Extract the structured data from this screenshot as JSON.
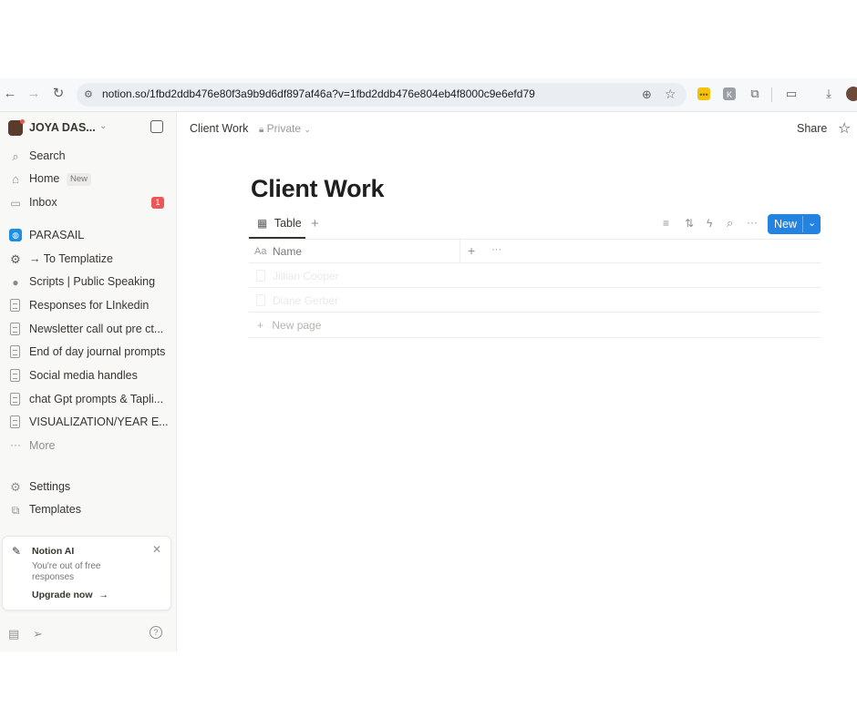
{
  "browser": {
    "url": "notion.so/1fbd2ddb476e80f3a9b9d6df897af46a?v=1fbd2ddb476e804eb4f8000c9e6efd79"
  },
  "sidebar": {
    "workspace": "JOYA DAS...",
    "items": [
      {
        "label": "Search",
        "icon": "search-icon"
      },
      {
        "label": "Home",
        "badge": "New",
        "icon": "home-icon"
      },
      {
        "label": "Inbox",
        "count": "1",
        "icon": "inbox-icon"
      }
    ],
    "pages": [
      {
        "label": "PARASAIL",
        "icon": "globe-icon"
      },
      {
        "label": "→ To Templatize",
        "icon": "gear-icon"
      },
      {
        "label": "Scripts | Public Speaking",
        "icon": "person-icon"
      },
      {
        "label": "Responses for LInkedin",
        "icon": "document-icon"
      },
      {
        "label": "Newsletter call out pre ct...",
        "icon": "document-icon"
      },
      {
        "label": "End of day journal prompts",
        "icon": "document-icon"
      },
      {
        "label": "Social media handles",
        "icon": "document-icon"
      },
      {
        "label": "chat Gpt prompts & Tapli...",
        "icon": "document-icon"
      },
      {
        "label": "VISUALIZATION/YEAR E...",
        "icon": "document-icon"
      }
    ],
    "more": "More",
    "settings": "Settings",
    "templates": "Templates",
    "ai_card": {
      "title": "Notion AI",
      "message": "You're out of free responses",
      "cta": "Upgrade now"
    }
  },
  "topbar": {
    "breadcrumb": "Client Work",
    "privacy": "Private",
    "share": "Share"
  },
  "page": {
    "title": "Client Work",
    "view_tab": "Table",
    "new_button": "New",
    "table": {
      "column": "Name",
      "column_type_icon": "Aa",
      "rows": [
        "Jillian Cooper",
        "Diane Gerber"
      ],
      "new_page": "New page"
    }
  },
  "colors": {
    "accent": "#2383e2",
    "badge_red": "#eb5757",
    "sidebar_bg": "#f8f8f7"
  }
}
